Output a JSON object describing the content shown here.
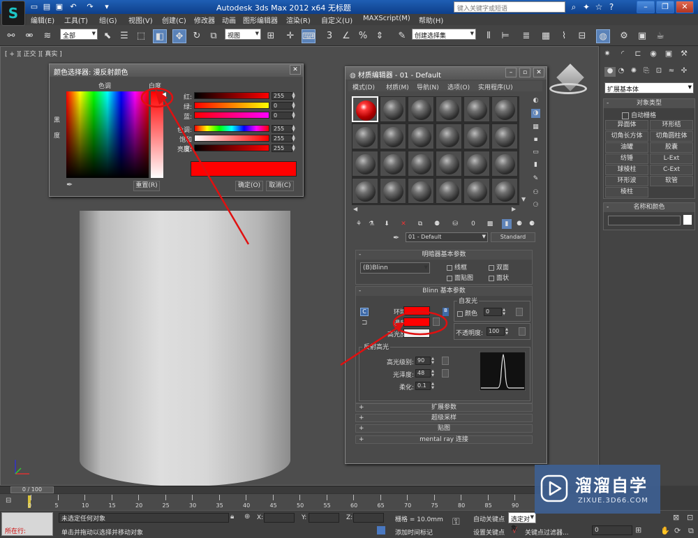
{
  "titlebar": {
    "logo": "S",
    "title": "Autodesk 3ds Max  2012 x64    无标题",
    "search_placeholder": "键入关键字或短语",
    "icons": [
      "new-icon",
      "open-icon",
      "save-icon",
      "undo-icon",
      "redo-icon",
      "binoculars-icon",
      "star-icon",
      "help-icon"
    ]
  },
  "menu": [
    "编辑(E)",
    "工具(T)",
    "组(G)",
    "视图(V)",
    "创建(C)",
    "修改器",
    "动画",
    "图形编辑器",
    "渲染(R)",
    "自定义(U)",
    "MAXScript(M)",
    "帮助(H)"
  ],
  "toolbar": {
    "filter_dropdown": "全部",
    "coord_dropdown": "视图",
    "selection_set": "创建选择集"
  },
  "viewport": {
    "label": "[ + ][ 正交 ][ 真实 ]"
  },
  "command_panel": {
    "category": "扩展基本体",
    "object_type_title": "对象类型",
    "autogrid": "自动栅格",
    "object_buttons": [
      "异面体",
      "环形结",
      "切角长方体",
      "切角圆柱体",
      "油罐",
      "胶囊",
      "纺锤",
      "L-Ext",
      "球棱柱",
      "C-Ext",
      "环形波",
      "软管",
      "棱柱"
    ],
    "name_color_title": "名称和颜色",
    "swatch_color": "#ffffff"
  },
  "color_picker": {
    "title": "颜色选择器: 漫反射颜色",
    "hue_label": "色调",
    "whiteness_label": "白度",
    "blackness_label": "黑度",
    "sliders": [
      {
        "label": "红:",
        "value": "255"
      },
      {
        "label": "绿:",
        "value": "0"
      },
      {
        "label": "蓝:",
        "value": "0"
      },
      {
        "label": "色调:",
        "value": "255"
      },
      {
        "label": "饱和度:",
        "value": "255"
      },
      {
        "label": "亮度:",
        "value": "255"
      }
    ],
    "preview_color": "#ff0000",
    "reset_button": "重置(R)",
    "ok_button": "确定(O)",
    "cancel_button": "取消(C)"
  },
  "material_editor": {
    "title": "材质编辑器 - 01 - Default",
    "menu": [
      "模式(D)",
      "材质(M)",
      "导航(N)",
      "选项(O)",
      "实用程序(U)"
    ],
    "material_name": "01 - Default",
    "material_type": "Standard",
    "shader_basic_title": "明暗器基本参数",
    "shader_type": "(B)Blinn",
    "shader_checkboxes": [
      "线框",
      "双面",
      "面贴图",
      "面状"
    ],
    "blinn_basic_title": "Blinn 基本参数",
    "self_illum_title": "自发光",
    "color_label": "颜色",
    "self_illum_value": "0",
    "ambient_label": "环境光:",
    "diffuse_label": "漫反射:",
    "specular_label": "高光反射:",
    "ambient_color": "#ff0000",
    "diffuse_color": "#ff0000",
    "specular_color": "#f0f0f0",
    "opacity_label": "不透明度:",
    "opacity_value": "100",
    "specular_highlights_title": "反射高光",
    "spec_level_label": "高光级别:",
    "spec_level_value": "90",
    "glossiness_label": "光泽度:",
    "glossiness_value": "48",
    "soften_label": "柔化:",
    "soften_value": "0.1",
    "collapsed_rollouts": [
      "扩展参数",
      "超级采样",
      "贴图",
      "mental ray 连接"
    ]
  },
  "timeline": {
    "frame_display": "0 / 100",
    "ticks": [
      "0",
      "5",
      "10",
      "15",
      "20",
      "25",
      "30",
      "35",
      "40",
      "45",
      "50",
      "55",
      "60",
      "65",
      "70",
      "75",
      "80",
      "85",
      "90"
    ]
  },
  "status": {
    "listener_label": "所在行:",
    "selection_status": "未选定任何对象",
    "prompt": "单击并拖动以选择并移动对象",
    "x_label": "X:",
    "y_label": "Y:",
    "z_label": "Z:",
    "grid": "栅格 = 10.0mm",
    "auto_key": "自动关键点",
    "selected_dropdown": "选定对象",
    "set_key": "设置关键点",
    "key_filters": "关键点过滤器...",
    "add_time_tag": "添加时间标记",
    "frame_value": "0"
  },
  "watermark": {
    "title": "溜溜自学",
    "subtitle": "ZIXUE.3D66.COM"
  }
}
